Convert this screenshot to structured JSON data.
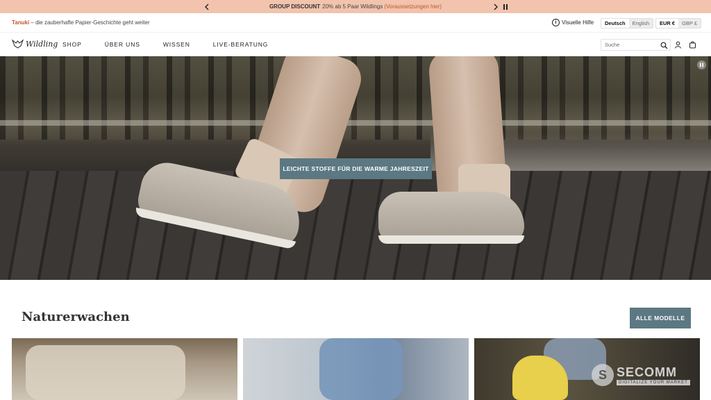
{
  "announcement": {
    "title": "GROUP DISCOUNT",
    "body": "20% ab 5 Paar Wildlings",
    "link": "(Voraussetzungen hier)"
  },
  "utility": {
    "promo_brand": "Tanuki",
    "promo_text": " – die zauberhafte Papier-Geschichte geht weiter",
    "help_label": "Visuelle Hilfe",
    "languages": [
      "Deutsch",
      "English"
    ],
    "currencies": [
      "EUR €",
      "GBP £"
    ]
  },
  "nav": {
    "logo_text": "Wildling",
    "items": [
      "SHOP",
      "ÜBER UNS",
      "WISSEN",
      "LIVE-BERATUNG"
    ],
    "search_placeholder": "Suche"
  },
  "hero": {
    "cta": "LEICHTE STOFFE FÜR DIE WARME JAHRESZEIT"
  },
  "collection": {
    "title": "Naturerwachen",
    "all_button": "ALLE MODELLE"
  },
  "watermark": {
    "name": "SECOMM",
    "tagline": "DIGITALIZE YOUR MARKET"
  },
  "colors": {
    "announcement_bg": "#f2c3ad",
    "accent_link": "#c2572a",
    "button": "#5b7883"
  }
}
